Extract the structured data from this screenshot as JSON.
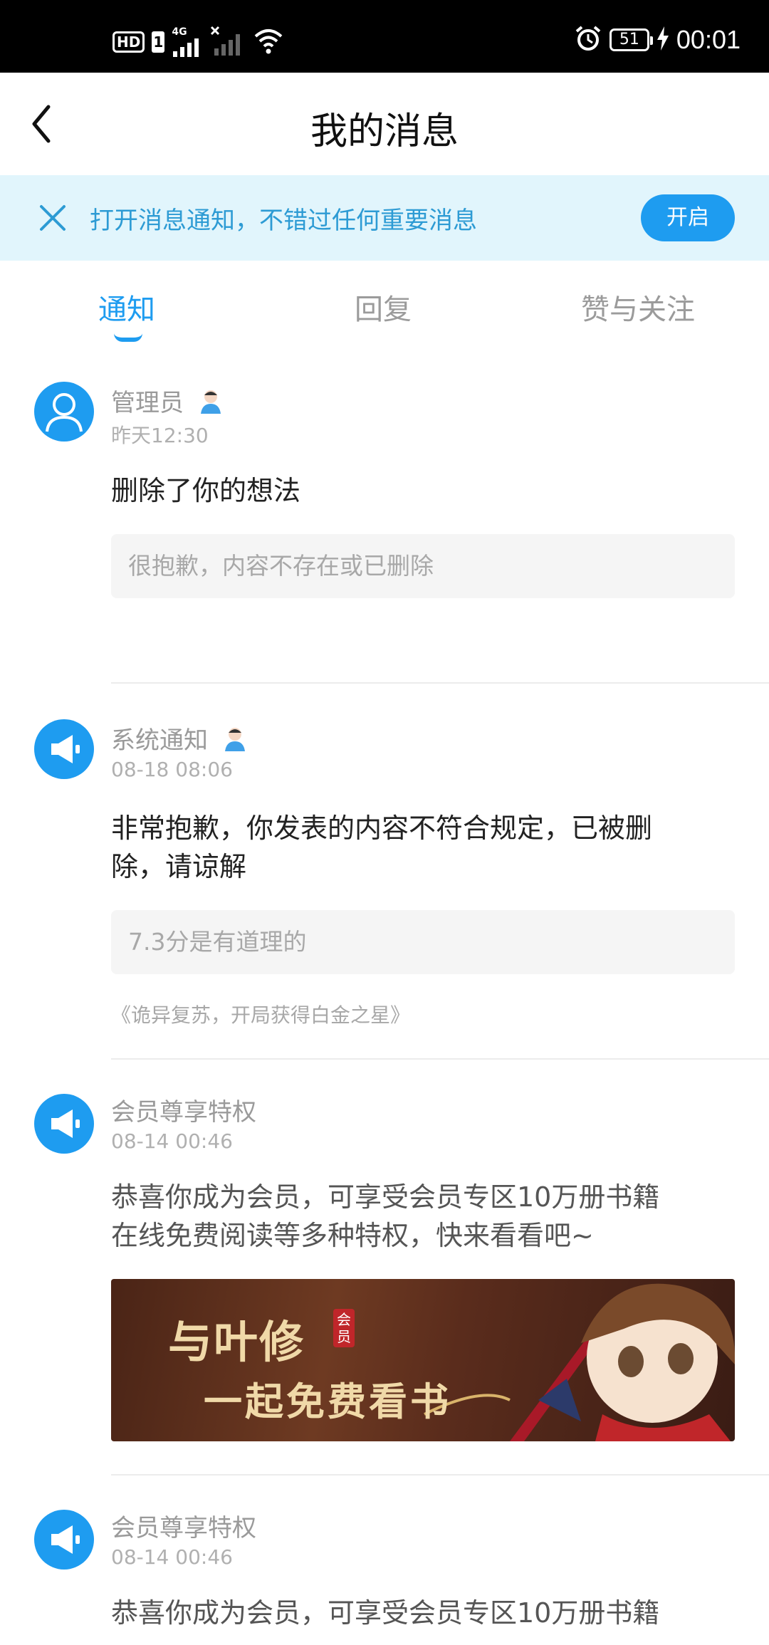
{
  "status_bar": {
    "hd": "HD",
    "sim": "1",
    "network": "4G",
    "battery": "51",
    "time": "00:01"
  },
  "header": {
    "title": "我的消息"
  },
  "banner": {
    "text": "打开消息通知，不错过任何重要消息",
    "button": "开启"
  },
  "tabs": [
    {
      "label": "通知",
      "active": true
    },
    {
      "label": "回复",
      "active": false
    },
    {
      "label": "赞与关注",
      "active": false
    }
  ],
  "messages": [
    {
      "sender": "管理员",
      "time": "昨天12:30",
      "text": "删除了你的想法",
      "quote": "很抱歉，内容不存在或已删除",
      "avatar_icon": "user-icon"
    },
    {
      "sender": "系统通知",
      "time": "08-18 08:06",
      "text_line1": "非常抱歉，你发表的内容不符合规定，已被删",
      "text_line2": "除，请谅解",
      "quote": "7.3分是有道理的",
      "book": "《诡异复苏，开局获得白金之星》",
      "avatar_icon": "megaphone-icon"
    },
    {
      "sender": "会员尊享特权",
      "time": "08-14 00:46",
      "text_line1": "恭喜你成为会员，可享受会员专区10万册书籍",
      "text_line2": "在线免费阅读等多种特权，快来看看吧~",
      "promo_line1": "与叶修",
      "promo_tag": "会员",
      "promo_line2": "一起免费看书",
      "avatar_icon": "megaphone-icon"
    },
    {
      "sender": "会员尊享特权",
      "time": "08-14 00:46",
      "text_line1": "恭喜你成为会员，可享受会员专区10万册书籍",
      "avatar_icon": "megaphone-icon"
    }
  ],
  "colors": {
    "accent": "#1e9cf0",
    "banner_bg": "#e1f5fc",
    "banner_text": "#2d9bd4"
  }
}
